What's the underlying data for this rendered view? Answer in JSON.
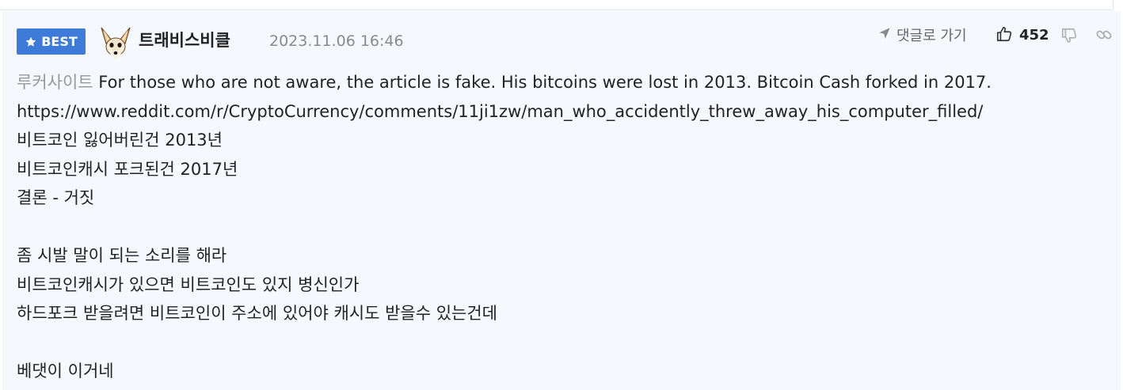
{
  "badge": {
    "label": "BEST",
    "icon": "star-icon",
    "color": "#3e7ad7"
  },
  "author": {
    "nickname": "트래비스비클",
    "avatar_icon": "fennec-fox-avatar"
  },
  "timestamp": "2023.11.06 16:46",
  "actions": {
    "goto_reply_label": "댓글로 가기",
    "like_count": "452",
    "goto_icon": "navigation-arrow-icon",
    "like_icon": "thumbs-up-icon",
    "dislike_icon": "thumbs-down-icon",
    "link_icon": "link-icon"
  },
  "body": {
    "quoted_name": "루커사이트",
    "quoted_text": "For those who are not aware, the article is fake. His bitcoins were lost in 2013. Bitcoin Cash forked in 2017.",
    "lines": [
      "https://www.reddit.com/r/CryptoCurrency/comments/11ji1zw/man_who_accidently_threw_away_his_computer_filled/",
      "비트코인 잃어버린건 2013년",
      "비트코인캐시 포크된건 2017년",
      "결론 - 거짓",
      "",
      "좀 시발 말이 되는 소리를 해라",
      "비트코인캐시가 있으면 비트코인도 있지 병신인가",
      "하드포크 받을려면 비트코인이 주소에 있어야 캐시도 받을수 있는건데",
      "",
      "베댓이 이거네"
    ]
  },
  "colors": {
    "comment_background": "#f5f8fd",
    "muted_text": "#999999"
  }
}
